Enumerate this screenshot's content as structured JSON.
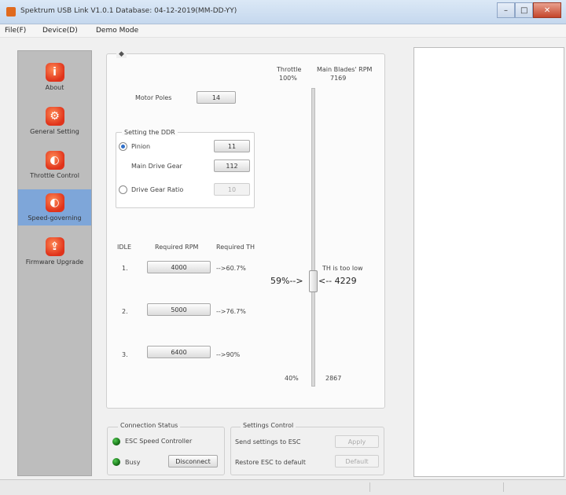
{
  "window": {
    "title": "Spektrum USB Link V1.0.1     Database: 04-12-2019(MM-DD-YY)",
    "controls": {
      "minimize": "–",
      "maximize": "□",
      "close": "✕"
    },
    "accent_color": "#e06a1e"
  },
  "menu": [
    "File(F)",
    "Device(D)",
    "Demo Mode"
  ],
  "sidebar": {
    "items": [
      {
        "label": "About",
        "icon": "info-icon",
        "glyph": "i"
      },
      {
        "label": "General Setting",
        "icon": "wrench-icon",
        "glyph": "⚙"
      },
      {
        "label": "Throttle Control",
        "icon": "dial-icon",
        "glyph": "◐"
      },
      {
        "label": "Speed-governing",
        "icon": "dial-icon",
        "glyph": "◐"
      },
      {
        "label": "Firmware Upgrade",
        "icon": "upgrade-icon",
        "glyph": "⇪"
      }
    ],
    "active": "Speed-governing"
  },
  "main": {
    "legend": "◆",
    "motor_poles_label": "Motor Poles",
    "motor_poles_value": "14",
    "ddr": {
      "legend": "Setting the DDR",
      "pinion_label": "Pinion",
      "pinion_value": "11",
      "main_gear_label": "Main Drive Gear",
      "main_gear_value": "112",
      "ratio_label": "Drive Gear Ratio",
      "ratio_value": "10",
      "selected": "Pinion"
    },
    "headers": {
      "idle": "IDLE",
      "rpm": "Required RPM",
      "th": "Required TH"
    },
    "rows": [
      {
        "n": "1.",
        "rpm": "4000",
        "th": "-->60.7%"
      },
      {
        "n": "2.",
        "rpm": "5000",
        "th": "-->76.7%"
      },
      {
        "n": "3.",
        "rpm": "6400",
        "th": "-->90%"
      }
    ],
    "slider": {
      "top_throttle_label": "Throttle",
      "top_throttle_value": "100%",
      "top_rpm_label": "Main Blades' RPM",
      "top_rpm_value": "7169",
      "current_label": "59%-->",
      "current_rpm": "<-- 4229",
      "warning": "TH is too low",
      "bottom_throttle": "40%",
      "bottom_rpm": "2867",
      "level_percent": 59
    }
  },
  "connection": {
    "legend": "Connection Status",
    "esc_label": "ESC Speed Controller",
    "busy_label": "Busy",
    "disconnect_label": "Disconnect"
  },
  "settings": {
    "legend": "Settings Control",
    "send_label": "Send settings to ESC",
    "apply_label": "Apply",
    "restore_label": "Restore ESC to default",
    "default_label": "Default"
  }
}
